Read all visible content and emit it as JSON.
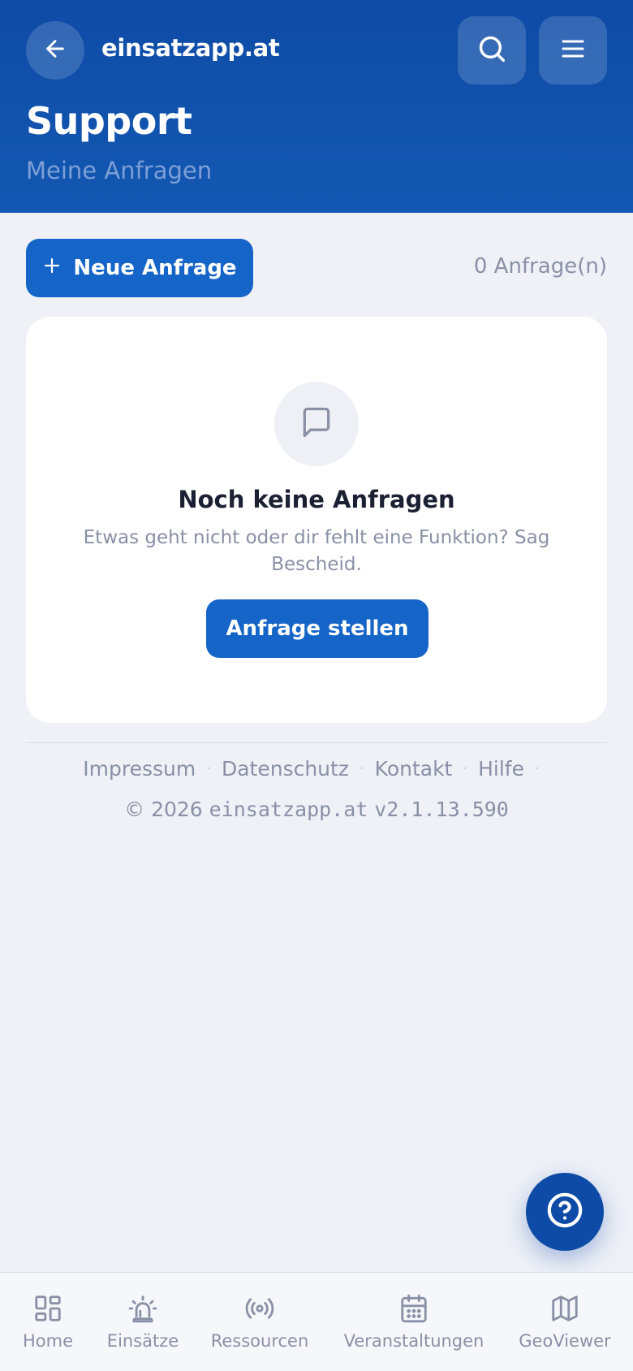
{
  "header": {
    "brand": "einsatzapp.at",
    "title": "Support",
    "subtitle": "Meine Anfragen",
    "back_icon": "arrow-left-icon",
    "search_icon": "search-icon",
    "menu_icon": "hamburger-menu-icon"
  },
  "toolbar": {
    "new_request_label": "Neue Anfrage",
    "count_text": "0 Anfrage(n)"
  },
  "empty_state": {
    "icon": "message-square-icon",
    "title": "Noch keine Anfragen",
    "text": "Etwas geht nicht oder dir fehlt eine Funktion? Sag Bescheid.",
    "button_label": "Anfrage stellen"
  },
  "footer": {
    "links": [
      "Impressum",
      "Datenschutz",
      "Kontakt",
      "Hilfe"
    ],
    "copyright": "© 2026",
    "site": "einsatzapp.at",
    "version": "v2.1.13.590"
  },
  "fab": {
    "icon": "help-circle-icon"
  },
  "bottom_nav": {
    "items": [
      {
        "label": "Home",
        "icon": "grid-icon"
      },
      {
        "label": "Einsätze",
        "icon": "siren-icon"
      },
      {
        "label": "Ressourcen",
        "icon": "broadcast-icon"
      },
      {
        "label": "Veranstaltungen",
        "icon": "calendar-icon"
      },
      {
        "label": "GeoViewer",
        "icon": "map-icon"
      }
    ]
  },
  "colors": {
    "header_bg": "#0e4ba6",
    "primary": "#1565c8",
    "page_bg": "#eff1f7",
    "muted_text": "#8a90a6"
  }
}
